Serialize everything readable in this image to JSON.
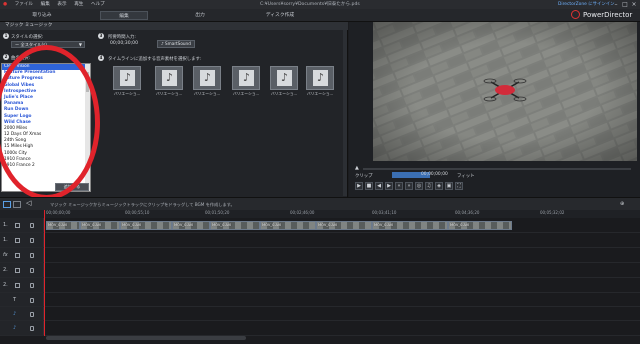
{
  "menubar": {
    "items": [
      "ファイル",
      "編集",
      "表示",
      "再生",
      "ヘルプ"
    ],
    "title": "C:¥Users¥sorry¥Documents¥旧泰たから.pds",
    "directorzone": "DirectorZone にサインイン"
  },
  "tabs": [
    "取り込み",
    "編集",
    "出力",
    "ディスク作成"
  ],
  "brand": "PowerDirector",
  "library": {
    "header": "マジック ミュージック",
    "step1_label": "スタイルの選択:",
    "style_select": "ー 全スタイル(s)",
    "step2_label": "曲の選択:",
    "styles": [
      "Clear Vision",
      "Feature Presentation",
      "Future Progress",
      "Global Vibes",
      "Introspective",
      "Julie's Place",
      "Panama",
      "Run Down",
      "Super Logo",
      "Wild Chase",
      "2000 Miles",
      "12 Days Of Xmas",
      "24th Song",
      "15 Miles High",
      "1000s City",
      "1910 France",
      "1910 France 2"
    ],
    "apply_button": "追加する",
    "step3_label": "所要時間入力:",
    "duration": "00;00;30;00",
    "smartsound_button": "SmartSound",
    "step4_label": "タイムラインに追加する音声素材を選択します:",
    "thumb_caption": "バリエーショ..."
  },
  "preview": {
    "clip_label": "クリップ",
    "timecode": "00;00;00;00",
    "fit_label": "フィット"
  },
  "timeline": {
    "hint": "マジック ミュージックからミュージックトラックにクリップをドラッグして BGM を作成します。",
    "ruler": [
      "00;00;00;00",
      "00;00;55;10",
      "00;01;50;20",
      "00;02;46;00",
      "00;03;41;10",
      "00;04;36;20",
      "00;05;32;02"
    ],
    "tracks": [
      "1.",
      "1.",
      "fx",
      "2.",
      "2.",
      "T",
      "♪",
      "♪"
    ],
    "clips": [
      "MOV_0.AVI",
      "MOV_0.AVI",
      "MOV_0.AVI",
      "MOV_0.AVI",
      "MOV_0.AVI",
      "MOV_0.AVI",
      "MOV_0.AVI",
      "MOV_0.AVI",
      "MOV_0.AVI"
    ]
  }
}
